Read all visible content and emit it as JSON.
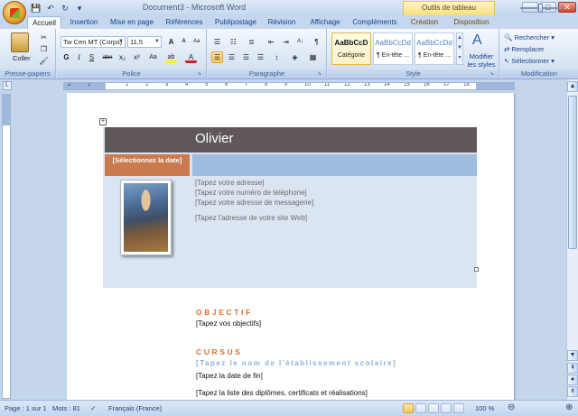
{
  "window": {
    "title": "Document3 - Microsoft Word",
    "contextual_tab_group": "Outils de tableau",
    "controls": {
      "minimize": "–",
      "maximize": "□",
      "close": "✕"
    }
  },
  "quick_access": {
    "save": "💾",
    "undo": "↶",
    "redo": "↻",
    "more": "▾"
  },
  "tabs": [
    {
      "label": "Accueil",
      "active": true
    },
    {
      "label": "Insertion"
    },
    {
      "label": "Mise en page"
    },
    {
      "label": "Références"
    },
    {
      "label": "Publipostage"
    },
    {
      "label": "Révision"
    },
    {
      "label": "Affichage"
    },
    {
      "label": "Compléments"
    },
    {
      "label": "Création"
    },
    {
      "label": "Disposition"
    }
  ],
  "ribbon": {
    "clipboard": {
      "label": "Presse-papiers",
      "paste": "Coller"
    },
    "font": {
      "label": "Police",
      "font_name": "Tw Cen MT (Corps)",
      "font_size": "11,5",
      "grow": "A",
      "shrink": "A",
      "clear": "Aa",
      "bold": "G",
      "italic": "I",
      "underline": "S",
      "strike": "abe",
      "subscript": "x₂",
      "superscript": "x²",
      "case": "Aa",
      "highlight": "ab",
      "color": "A"
    },
    "paragraph": {
      "label": "Paragraphe",
      "sort": "A↓",
      "marks": "¶"
    },
    "styles": {
      "label": "Style",
      "items": [
        {
          "sample": "AaBbCcD",
          "name": "Catégorie",
          "selected": true
        },
        {
          "sample": "AaBbCcDd",
          "name": "¶ En-tête ..."
        },
        {
          "sample": "AaBbCcDd",
          "name": "¶ En-tête ..."
        }
      ],
      "change": "Modifier les styles"
    },
    "editing": {
      "label": "Modification",
      "find": "Rechercher",
      "replace": "Remplacer",
      "select": "Sélectionner"
    }
  },
  "ruler_numbers": [
    "2",
    "1",
    "1",
    "2",
    "3",
    "4",
    "5",
    "6",
    "7",
    "8",
    "9",
    "10",
    "11",
    "12",
    "13",
    "14",
    "15",
    "16",
    "17",
    "18"
  ],
  "document": {
    "name": "Olivier",
    "date_placeholder": "[Sélectionnez la date]",
    "contact_lines": [
      "[Tapez votre adresse]",
      "[Tapez votre numéro de téléphone]",
      "[Tapez votre adresse de messagerie]"
    ],
    "website": "[Tapez l'adresse de votre site Web]",
    "objective_heading": "OBJECTIF",
    "objective_text": "[Tapez vos objectifs]",
    "education_heading": "CURSUS",
    "school_placeholder": "[Tapez le nom de l'établissement scolaire]",
    "end_date": "[Tapez la date de fin]",
    "diplomas": "[Tapez la liste des diplômes, certificats et réalisations]"
  },
  "status": {
    "page": "Page : 1 sur 1",
    "words": "Mots : 81",
    "language": "Français (France)",
    "zoom": "100 %",
    "zoom_minus": "⊖",
    "zoom_plus": "⊕"
  }
}
